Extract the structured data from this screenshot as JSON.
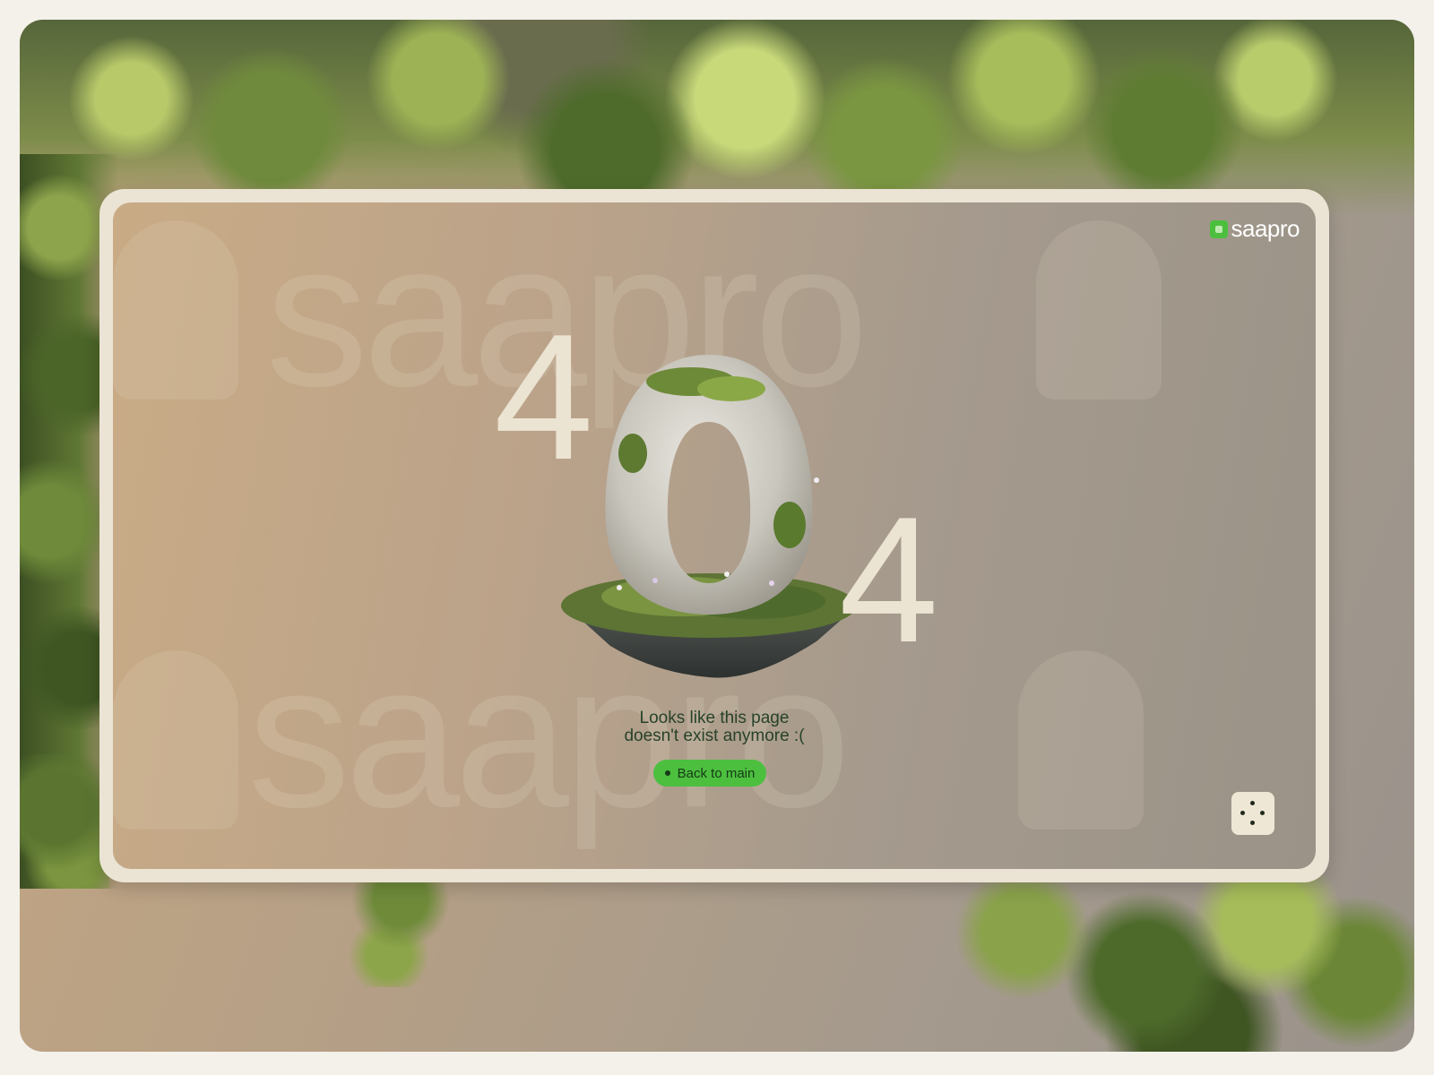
{
  "brand": {
    "logo_text": "saapro",
    "accent_color": "#4cbf3f",
    "watermark_text": "saapro"
  },
  "error": {
    "digit_first": "4",
    "digit_last": "4",
    "message_line1": "Looks like this page",
    "message_line2": "doesn't exist anymore :("
  },
  "actions": {
    "back_label": "Back to main",
    "dice_icon": "dice-icon"
  }
}
